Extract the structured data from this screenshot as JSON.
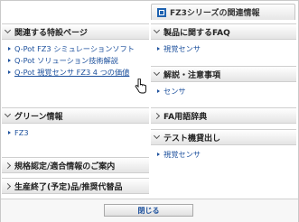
{
  "tab": {
    "label": "FZ3シリーズの関連情報"
  },
  "left": {
    "sections": [
      {
        "title": "関連する特設ページ",
        "expanded": true,
        "links": [
          "Q-Pot FZ3 シミュレーションソフト",
          "Q-Pot ソリューション技術解説",
          "Q-Pot 視覚センサ FZ3 4 つの価値"
        ]
      },
      {
        "title": "グリーン情報",
        "expanded": true,
        "links": [
          "FZ3"
        ]
      },
      {
        "title": "規格認定/適合情報のご案内",
        "expanded": false,
        "links": []
      },
      {
        "title": "生産終了(予定)品/推奨代替品",
        "expanded": false,
        "links": []
      }
    ]
  },
  "right": {
    "sections": [
      {
        "title": "製品に関するFAQ",
        "expanded": true,
        "links": [
          "視覚センサ"
        ]
      },
      {
        "title": "解説・注意事項",
        "expanded": true,
        "links": [
          "センサ"
        ]
      },
      {
        "title": "FA用語辞典",
        "expanded": false,
        "links": []
      },
      {
        "title": "テスト機貸出し",
        "expanded": true,
        "links": [
          "視覚センサ"
        ]
      }
    ]
  },
  "footer": {
    "close_label": "閉じる"
  }
}
